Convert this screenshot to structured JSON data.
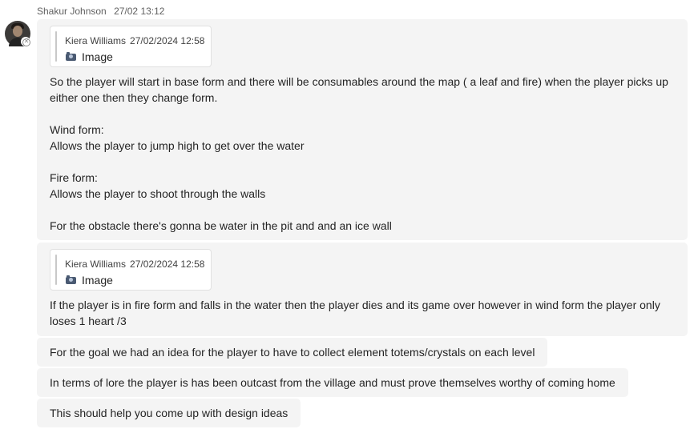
{
  "header": {
    "sender": "Shakur Johnson",
    "time": "27/02 13:12"
  },
  "messages": [
    {
      "quote": {
        "author": "Kiera Williams",
        "time": "27/02/2024 12:58",
        "attachment": "Image"
      },
      "lines": [
        "So the player will start in base form and there will be consumables around the map ( a leaf and fire) when the player picks up",
        "either one then they change form.",
        "",
        "Wind form:",
        "Allows the player to jump high to get over the water",
        "",
        "Fire form:",
        "Allows the player to shoot through the walls",
        "",
        "For the obstacle there's gonna be water in the pit and and an ice wall"
      ]
    },
    {
      "quote": {
        "author": "Kiera Williams",
        "time": "27/02/2024 12:58",
        "attachment": "Image"
      },
      "lines": [
        "If the player is in fire form and falls in the water then the player dies and its game over however in wind form the player only",
        "loses 1 heart /3"
      ]
    },
    {
      "text": "For the goal we had an idea for the player to have to collect element totems/crystals on each level"
    },
    {
      "text": "In terms of lore the player is has been outcast from the village and must prove themselves worthy of coming home"
    },
    {
      "text": "This should help you come up with design ideas"
    }
  ],
  "icons": {
    "attachment_icon": "camera-icon",
    "status_icon": "offline-status-icon"
  }
}
